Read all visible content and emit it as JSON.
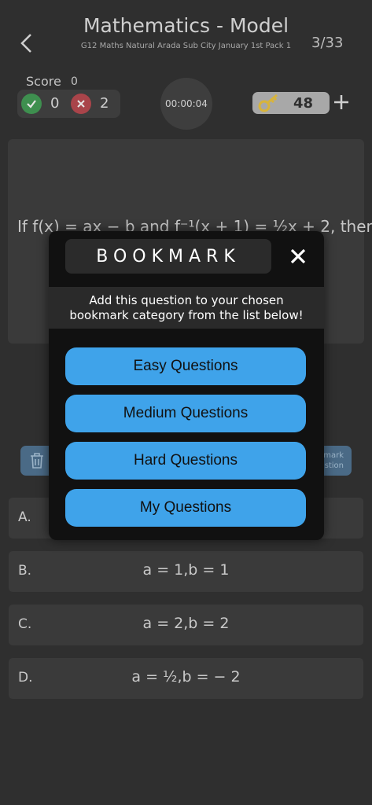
{
  "header": {
    "title": "Mathematics - Model",
    "subtitle": "G12 Maths Natural Arada Sub City January 1st Pack 1",
    "counter": "3/33"
  },
  "score": {
    "label": "Score",
    "value": "0",
    "correct": "0",
    "wrong": "2"
  },
  "timer": "00:00:04",
  "keys": {
    "count": "48"
  },
  "question": {
    "text": "If f(x) = ax − b and f⁻¹(x + 1) = ½x + 2, then"
  },
  "toolbar": {
    "bookmark_label_1": "mark",
    "bookmark_label_2": "stion"
  },
  "options": [
    {
      "letter": "A.",
      "value": ""
    },
    {
      "letter": "B.",
      "value": "a = 1,b = 1"
    },
    {
      "letter": "C.",
      "value": "a = 2,b = 2"
    },
    {
      "letter": "D.",
      "value": "a = ½,b = − 2"
    }
  ],
  "modal": {
    "title": "BOOKMARK",
    "description_line1": "Add this question to your chosen",
    "description_line2": "bookmark category from the list below!",
    "categories": [
      "Easy Questions",
      "Medium Questions",
      "Hard Questions",
      "My Questions"
    ]
  },
  "colors": {
    "accent": "#3fa3ea",
    "correct": "#3e8f4f",
    "wrong": "#a9444a"
  }
}
